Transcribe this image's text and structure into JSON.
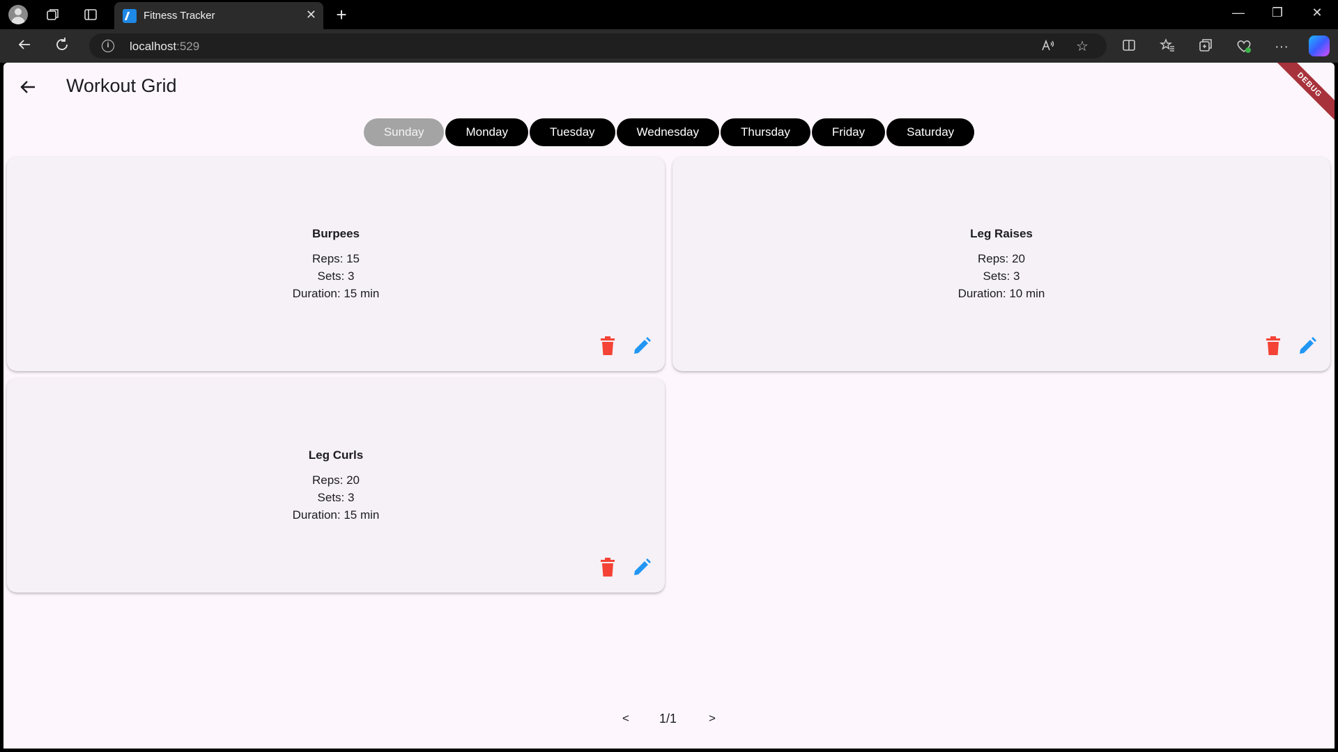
{
  "browser": {
    "tab_title": "Fitness Tracker",
    "tab_close": "✕",
    "new_tab": "+",
    "url_host": "localhost",
    "url_port": ":529",
    "window_controls": {
      "minimize": "—",
      "restore": "❐",
      "close": "✕"
    }
  },
  "app": {
    "title": "Workout Grid",
    "debug_label": "DEBUG",
    "days": [
      "Sunday",
      "Monday",
      "Tuesday",
      "Wednesday",
      "Thursday",
      "Friday",
      "Saturday"
    ],
    "selected_day": "Sunday",
    "workouts": [
      {
        "name": "Burpees",
        "reps": "Reps: 15",
        "sets": "Sets: 3",
        "duration": "Duration: 15 min"
      },
      {
        "name": "Leg Raises",
        "reps": "Reps: 20",
        "sets": "Sets: 3",
        "duration": "Duration: 10 min"
      },
      {
        "name": "Leg Curls",
        "reps": "Reps: 20",
        "sets": "Sets: 3",
        "duration": "Duration: 15 min"
      }
    ],
    "pager": {
      "prev": "<",
      "page": "1/1",
      "next": ">"
    }
  },
  "colors": {
    "delete": "#f44336",
    "edit": "#2196f3",
    "selected_day": "#a4a4a4",
    "day": "#000000",
    "background": "#fdf7fd"
  },
  "icons": {
    "delete": "trash-icon",
    "edit": "pencil-icon",
    "back": "back-arrow-icon"
  }
}
